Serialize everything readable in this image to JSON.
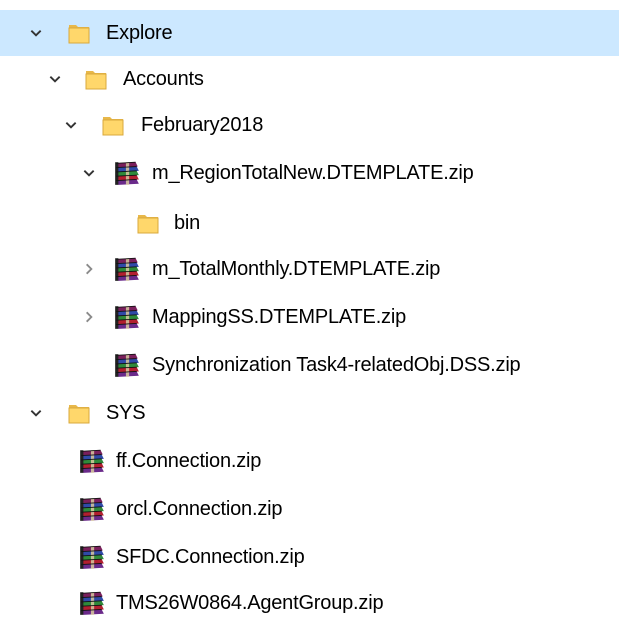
{
  "colors": {
    "selection": "#cce8ff",
    "folder": "#ffd76b",
    "folder_dark": "#e0b040",
    "chevron": "#333333"
  },
  "tree": {
    "explore": {
      "label": "Explore",
      "icon": "folder-icon",
      "expanded": true
    },
    "accounts": {
      "label": "Accounts",
      "icon": "folder-icon",
      "expanded": true
    },
    "february": {
      "label": "February2018",
      "icon": "folder-icon",
      "expanded": true
    },
    "region_total": {
      "label": "m_RegionTotalNew.DTEMPLATE.zip",
      "icon": "winrar-archive-icon",
      "expanded": true
    },
    "bin": {
      "label": "bin",
      "icon": "folder-icon"
    },
    "total_monthly": {
      "label": "m_TotalMonthly.DTEMPLATE.zip",
      "icon": "winrar-archive-icon",
      "expanded": false
    },
    "mapping_ss": {
      "label": "MappingSS.DTEMPLATE.zip",
      "icon": "winrar-archive-icon",
      "expanded": false
    },
    "sync_task": {
      "label": "Synchronization Task4-relatedObj.DSS.zip",
      "icon": "winrar-archive-icon"
    },
    "sys": {
      "label": "SYS",
      "icon": "folder-icon",
      "expanded": true
    },
    "ff_conn": {
      "label": "ff.Connection.zip",
      "icon": "winrar-archive-icon"
    },
    "orcl_conn": {
      "label": "orcl.Connection.zip",
      "icon": "winrar-archive-icon"
    },
    "sfdc_conn": {
      "label": "SFDC.Connection.zip",
      "icon": "winrar-archive-icon"
    },
    "agent_group": {
      "label": "TMS26W0864.AgentGroup.zip",
      "icon": "winrar-archive-icon"
    }
  }
}
